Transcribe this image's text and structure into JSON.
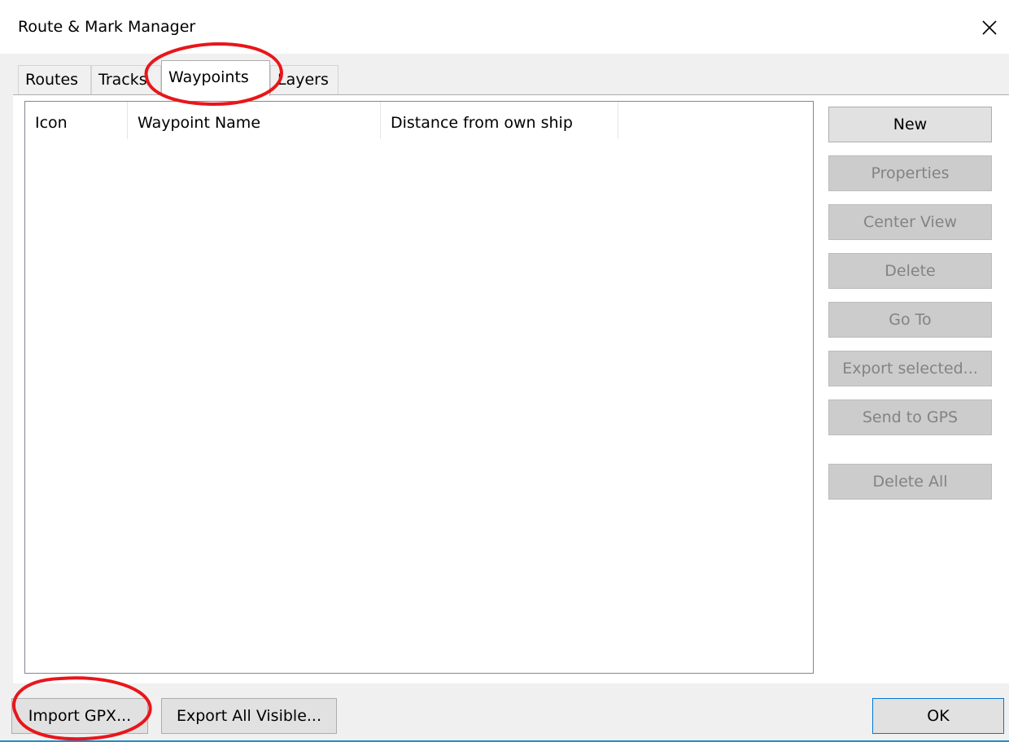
{
  "window": {
    "title": "Route & Mark Manager",
    "close_glyph": "×"
  },
  "tabs": [
    {
      "label": "Routes"
    },
    {
      "label": "Tracks"
    },
    {
      "label": "Waypoints",
      "active": true
    },
    {
      "label": "Layers"
    }
  ],
  "list": {
    "columns": [
      "Icon",
      "Waypoint Name",
      "Distance from own ship"
    ],
    "rows": []
  },
  "side_buttons": [
    {
      "label": "New",
      "enabled": true
    },
    {
      "label": "Properties",
      "enabled": false
    },
    {
      "label": "Center View",
      "enabled": false
    },
    {
      "label": "Delete",
      "enabled": false
    },
    {
      "label": "Go To",
      "enabled": false
    },
    {
      "label": "Export selected...",
      "enabled": false
    },
    {
      "label": "Send to GPS",
      "enabled": false
    },
    {
      "label": "Delete All",
      "enabled": false
    }
  ],
  "bottom_buttons": {
    "import": "Import GPX...",
    "export": "Export All Visible...",
    "ok": "OK"
  },
  "colors": {
    "annotation": "#e8161b",
    "accent_line": "#1e90c8"
  },
  "icons": {
    "close": "close-icon"
  }
}
